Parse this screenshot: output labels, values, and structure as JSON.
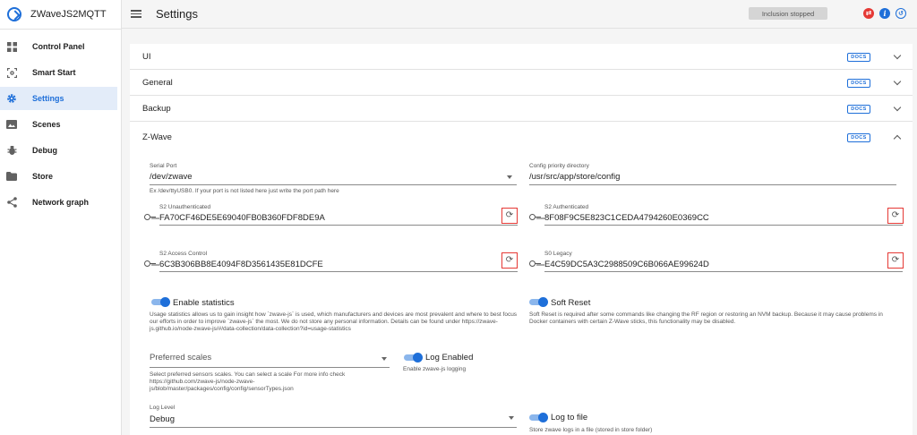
{
  "app": {
    "name": "ZWaveJS2MQTT",
    "page_title": "Settings"
  },
  "sidebar": {
    "items": [
      {
        "label": "Control Panel",
        "icon": "grid-icon"
      },
      {
        "label": "Smart Start",
        "icon": "scan-icon"
      },
      {
        "label": "Settings",
        "icon": "gear-icon",
        "active": true
      },
      {
        "label": "Scenes",
        "icon": "scenes-icon"
      },
      {
        "label": "Debug",
        "icon": "bug-icon"
      },
      {
        "label": "Store",
        "icon": "folder-icon"
      },
      {
        "label": "Network graph",
        "icon": "share-icon"
      }
    ]
  },
  "topbar": {
    "inclusion_status": "Inclusion stopped"
  },
  "colors": {
    "accent": "#1e6fd9",
    "error": "#e53935"
  },
  "panels": {
    "docs_label": "DOCS",
    "ui": "UI",
    "general": "General",
    "backup": "Backup",
    "zwave": "Z-Wave"
  },
  "zwave": {
    "serial_port": {
      "label": "Serial Port",
      "value": "/dev/zwave",
      "hint": "Ex /dev/ttyUSB0. If your port is not listed here just write the port path here"
    },
    "config_dir": {
      "label": "Config priority directory",
      "value": "/usr/src/app/store/config"
    },
    "s2_unauth": {
      "label": "S2 Unauthenticated",
      "value": "FA70CF46DE5E69040FB0B360FDF8DE9A"
    },
    "s2_auth": {
      "label": "S2 Authenticated",
      "value": "8F08F9C5E823C1CEDA4794260E0369CC"
    },
    "s2_access": {
      "label": "S2 Access Control",
      "value": "6C3B306BB8E4094F8D3561435E81DCFE"
    },
    "s0_legacy": {
      "label": "S0 Legacy",
      "value": "E4C59DC5A3C2988509C6B066AE99624D"
    },
    "enable_statistics": {
      "label": "Enable statistics",
      "enabled": true,
      "hint": "Usage statistics allows us to gain insight how `zwave-js` is used, which manufacturers and devices are most prevalent and where to best focus our efforts in order to improve `zwave-js` the most. We do not store any personal information. Details can be found under https://zwave-js.github.io/node-zwave-js/#/data-collection/data-collection?id=usage-statistics"
    },
    "soft_reset": {
      "label": "Soft Reset",
      "enabled": true,
      "hint": "Soft Reset is required after some commands like changing the RF region or restoring an NVM backup. Because it may cause problems in Docker containers with certain Z-Wave sticks, this functionality may be disabled."
    },
    "preferred_scales": {
      "placeholder": "Preferred scales",
      "hint": "Select preferred sensors scales. You can select a scale For more info check https://github.com/zwave-js/node-zwave-js/blob/master/packages/config/config/sensorTypes.json"
    },
    "log_enabled": {
      "label": "Log Enabled",
      "enabled": true,
      "hint": "Enable zwave-js logging"
    },
    "log_level": {
      "label": "Log Level",
      "value": "Debug"
    },
    "log_to_file": {
      "label": "Log to file",
      "enabled": true,
      "hint": "Store zwave logs in a file (stored in store folder)"
    }
  }
}
